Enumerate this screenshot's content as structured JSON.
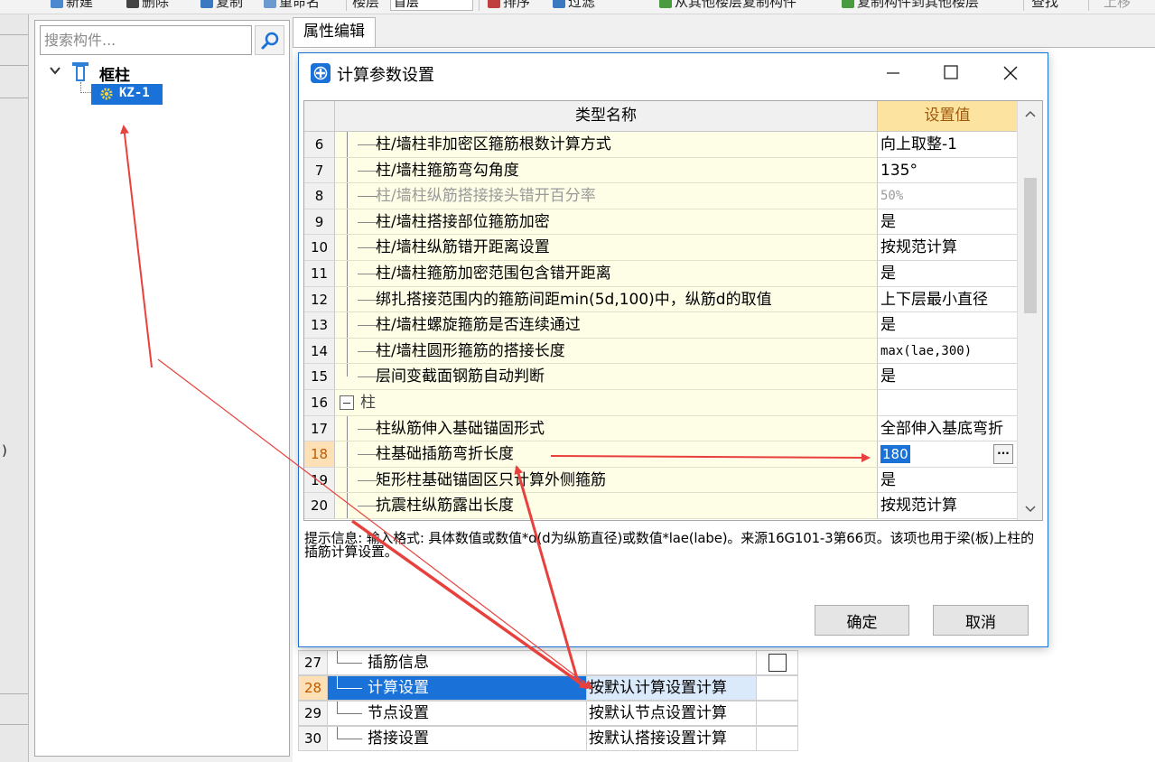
{
  "toolbar": {
    "items": [
      "新建",
      "删除",
      "复制",
      "重命名",
      "楼层",
      "首层",
      "排序",
      "过滤",
      "从其他楼层复制构件",
      "复制构件到其他楼层",
      "查找",
      "上移"
    ]
  },
  "tree": {
    "search_placeholder": "搜索构件...",
    "root_label": "框柱",
    "child_label": "KZ-1"
  },
  "property_panel": {
    "tab_label": "属性编辑",
    "rows": [
      {
        "num": "27",
        "name": "插筋信息",
        "value": "",
        "has_checkbox": true
      },
      {
        "num": "28",
        "name": "计算设置",
        "value": "按默认计算设置计算",
        "selected": true
      },
      {
        "num": "29",
        "name": "节点设置",
        "value": "按默认节点设置计算"
      },
      {
        "num": "30",
        "name": "搭接设置",
        "value": "按默认搭接设置计算"
      }
    ]
  },
  "dialog": {
    "title": "计算参数设置",
    "columns": {
      "name": "类型名称",
      "value": "设置值"
    },
    "rows": [
      {
        "num": "6",
        "name": "柱/墙柱非加密区箍筋根数计算方式",
        "value": "向上取整-1"
      },
      {
        "num": "7",
        "name": "柱/墙柱箍筋弯勾角度",
        "value": "135°"
      },
      {
        "num": "8",
        "name": "柱/墙柱纵筋搭接接头错开百分率",
        "value": "50%",
        "disabled": true
      },
      {
        "num": "9",
        "name": "柱/墙柱搭接部位箍筋加密",
        "value": "是"
      },
      {
        "num": "10",
        "name": "柱/墙柱纵筋错开距离设置",
        "value": "按规范计算"
      },
      {
        "num": "11",
        "name": "柱/墙柱箍筋加密范围包含错开距离",
        "value": "是"
      },
      {
        "num": "12",
        "name": "绑扎搭接范围内的箍筋间距min(5d,100)中，纵筋d的取值",
        "value": "上下层最小直径"
      },
      {
        "num": "13",
        "name": "柱/墙柱螺旋箍筋是否连续通过",
        "value": "是"
      },
      {
        "num": "14",
        "name": "柱/墙柱圆形箍筋的搭接长度",
        "value": "max(lae,300)",
        "mono": true
      },
      {
        "num": "15",
        "name": "层间变截面钢筋自动判断",
        "value": "是",
        "last": true
      },
      {
        "num": "16",
        "name": "柱",
        "value": "",
        "group": true
      },
      {
        "num": "17",
        "name": "柱纵筋伸入基础锚固形式",
        "value": "全部伸入基底弯折"
      },
      {
        "num": "18",
        "name": "柱基础插筋弯折长度",
        "value": "180",
        "editing": true,
        "current": true
      },
      {
        "num": "19",
        "name": "矩形柱基础锚固区只计算外侧箍筋",
        "value": "是"
      },
      {
        "num": "20",
        "name": "抗震柱纵筋露出长度",
        "value": "按规范计算"
      }
    ],
    "hint": "提示信息: 输入格式: 具体数值或数值*d(d为纵筋直径)或数值*lae(labe)。来源16G101-3第66页。该项也用于梁(板)上柱的插筋计算设置。",
    "ok_label": "确定",
    "cancel_label": "取消",
    "ellipsis_label": "···"
  },
  "colors": {
    "accent": "#1a72d9",
    "arrow": "#e8413d",
    "header_value_bg": "#fde3a0",
    "row_name_bg": "#fefde6"
  }
}
